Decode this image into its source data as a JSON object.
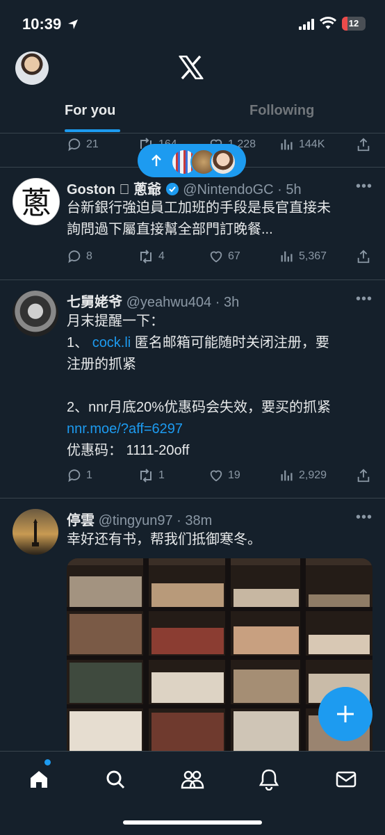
{
  "status_bar": {
    "time": "10:39",
    "battery": "12"
  },
  "header": {
    "tabs": [
      {
        "label": "For you"
      },
      {
        "label": "Following"
      }
    ]
  },
  "top_actions": {
    "reply": "21",
    "retweet": "164",
    "like": "1,228",
    "views": "144K"
  },
  "tweets": [
    {
      "name": "Goston  蔥爺",
      "handle": "@NintendoGC",
      "time": "5h",
      "lines": [
        "台新銀行強迫員工加班的手段是長官直接未",
        "詢問過下屬直接幫全部門訂晚餐..."
      ],
      "reply": "8",
      "retweet": "4",
      "like": "67",
      "views": "5,367"
    },
    {
      "name": "七舅姥爷",
      "handle": "@yeahwu404",
      "time": "3h",
      "line1": "月末提醒一下：",
      "line2_prefix": "1、",
      "line2_link": "cock.li",
      "line2_rest": "匿名邮箱可能随时关闭注册，要",
      "line3": "注册的抓紧",
      "line4": "2、nnr月底20%优惠码会失效，要买的抓紧",
      "line5_link": "nnr.moe/?aff=6297",
      "line6": "优惠码： 1111-20off",
      "reply": "1",
      "retweet": "1",
      "like": "19",
      "views": "2,929"
    },
    {
      "name": "停雲",
      "handle": "@tingyun97",
      "time": "38m",
      "text": "幸好还有书，帮我们抵御寒冬。"
    }
  ],
  "colors": {
    "background": "#15202b",
    "accent": "#1d9bf0",
    "muted": "#8b98a5",
    "divider": "#38444d"
  },
  "icons": [
    "location-arrow-icon",
    "signal-icon",
    "wifi-icon",
    "battery-icon",
    "x-logo-icon",
    "reply-icon",
    "retweet-icon",
    "like-icon",
    "views-icon",
    "share-icon",
    "more-icon",
    "plus-icon",
    "home-icon",
    "search-icon",
    "communities-icon",
    "notifications-icon",
    "messages-icon",
    "arrow-up-icon",
    "verified-icon"
  ]
}
